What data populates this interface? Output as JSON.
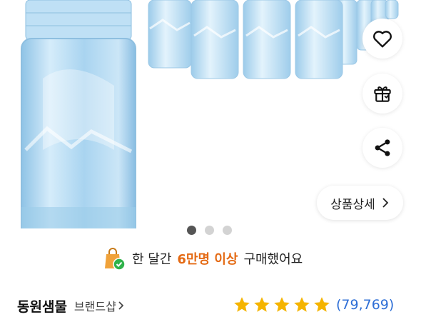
{
  "actions": {
    "wishlist": "heart-icon",
    "gift": "gift-icon",
    "share": "share-icon",
    "detail_label": "상품상세"
  },
  "carousel": {
    "total": 3,
    "active": 1
  },
  "purchase_notice": {
    "prefix": "한 달간",
    "highlight": "6만명 이상",
    "suffix": "구매했어요"
  },
  "product": {
    "brand": "동원샘물",
    "brand_shop_label": "브랜드샵",
    "rating_fraction": 0.95,
    "review_count": "(79,769)"
  },
  "colors": {
    "highlight": "#e46a14",
    "star": "#f5b400",
    "link": "#2f6fd6",
    "badge_check": "#2fb24a"
  }
}
